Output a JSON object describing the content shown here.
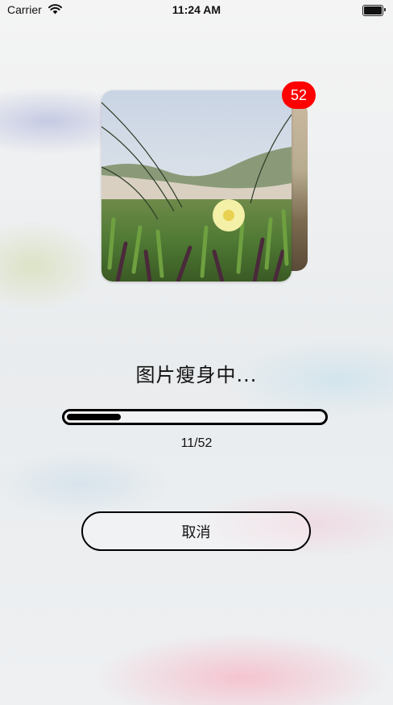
{
  "status_bar": {
    "carrier": "Carrier",
    "time": "11:24 AM",
    "wifi_icon": "wifi-icon",
    "battery_icon": "battery-icon"
  },
  "photo": {
    "badge_count": "52"
  },
  "compress": {
    "title": "图片瘦身中...",
    "progress_text": "11/52",
    "progress_fraction": 0.2115
  },
  "actions": {
    "cancel_label": "取消"
  },
  "colors": {
    "badge": "#ff0000",
    "progress": "#000000"
  }
}
